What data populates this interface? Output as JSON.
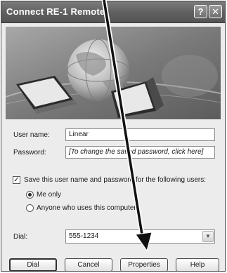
{
  "window": {
    "title": "Connect RE-1 Remote",
    "help_glyph": "?",
    "close_glyph": "✕"
  },
  "form": {
    "user_name_label": "User name:",
    "user_name_value": "Linear",
    "password_label": "Password:",
    "password_value": "[To change the saved password, click here]",
    "save_checkbox_checked": true,
    "save_label": "Save this user name and password for the following users:",
    "radio_me_label": "Me only",
    "radio_anyone_label": "Anyone who uses this computer",
    "selected_radio": "me_only",
    "dial_label": "Dial:",
    "dial_value": "555-1234"
  },
  "buttons": {
    "dial": "Dial",
    "cancel": "Cancel",
    "properties": "Properties",
    "help": "Help"
  },
  "icons": [
    "help-icon",
    "close-icon",
    "globe-icon",
    "laptop-icon",
    "checkmark-icon",
    "chevron-down-icon",
    "arrow-icon"
  ],
  "colors": {
    "titlebar": "#5f5f5f",
    "dialog_background": "#ececec"
  }
}
